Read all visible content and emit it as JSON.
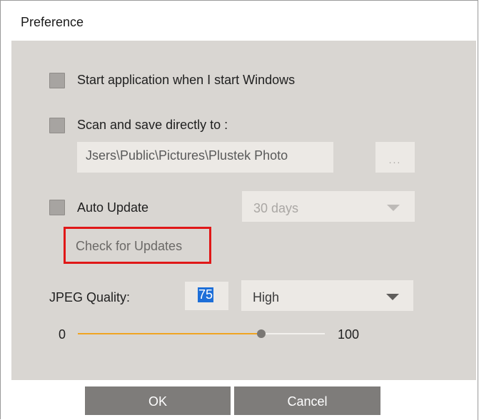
{
  "window": {
    "title": "Preference"
  },
  "start_app": {
    "label": "Start application when I start Windows",
    "checked": false
  },
  "scan_save": {
    "label": "Scan and save directly to :",
    "checked": false,
    "path_value": "Jsers\\Public\\Pictures\\Plustek Photo",
    "browse_label": "..."
  },
  "auto_update": {
    "label": "Auto Update",
    "checked": false,
    "interval_value": "30 days",
    "check_button_label": "Check for Updates"
  },
  "jpeg": {
    "label": "JPEG Quality:",
    "quality_value": "75",
    "preset_value": "High",
    "slider_min": "0",
    "slider_max": "100",
    "slider_value": 75
  },
  "buttons": {
    "ok": "OK",
    "cancel": "Cancel"
  },
  "colors": {
    "panel": "#d9d6d2",
    "accent_slider": "#f0a422",
    "highlight": "#e01818",
    "selection": "#1e6fd8",
    "button": "#7e7c7a"
  }
}
